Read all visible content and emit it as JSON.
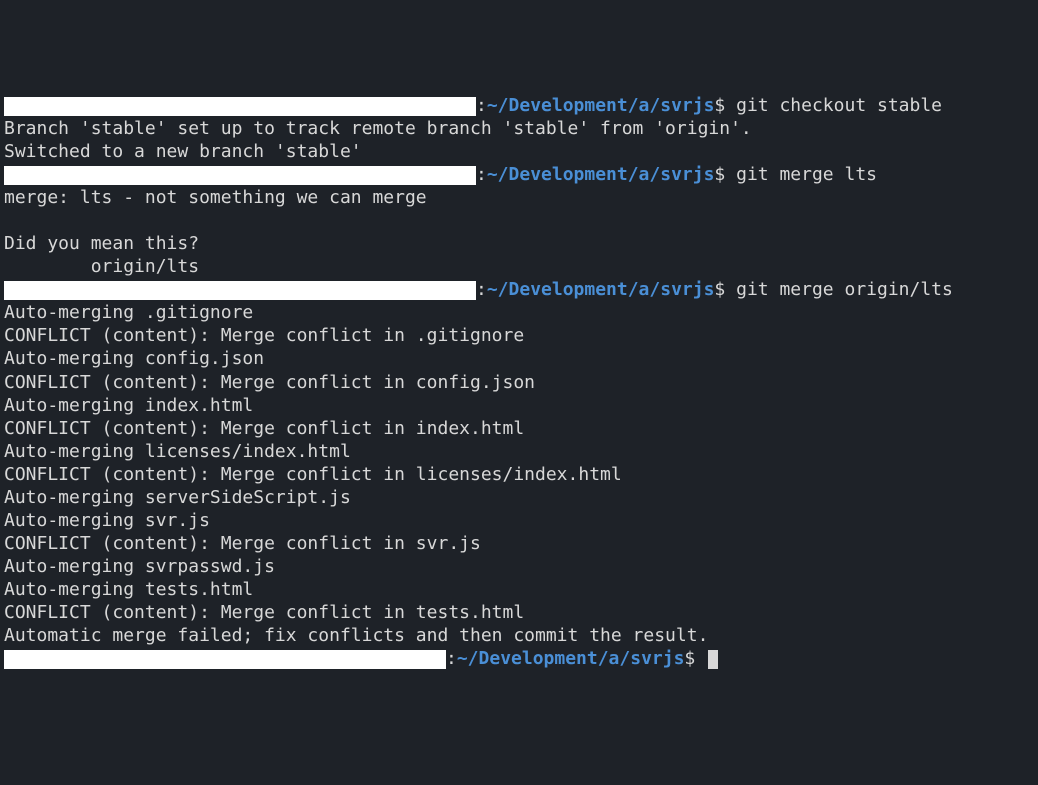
{
  "prompt": {
    "colon": ":",
    "path": "~/Development/a/svrjs",
    "dollar": "$ "
  },
  "blocks": [
    {
      "redactedClass": "r1",
      "command": "git checkout stable",
      "output": [
        "Branch 'stable' set up to track remote branch 'stable' from 'origin'.",
        "Switched to a new branch 'stable'"
      ]
    },
    {
      "redactedClass": "r1",
      "command": "git merge lts",
      "output": [
        "merge: lts - not something we can merge",
        "",
        "Did you mean this?",
        "        origin/lts"
      ]
    },
    {
      "redactedClass": "r1",
      "command": "git merge origin/lts",
      "output": [
        "Auto-merging .gitignore",
        "CONFLICT (content): Merge conflict in .gitignore",
        "Auto-merging config.json",
        "CONFLICT (content): Merge conflict in config.json",
        "Auto-merging index.html",
        "CONFLICT (content): Merge conflict in index.html",
        "Auto-merging licenses/index.html",
        "CONFLICT (content): Merge conflict in licenses/index.html",
        "Auto-merging serverSideScript.js",
        "Auto-merging svr.js",
        "CONFLICT (content): Merge conflict in svr.js",
        "Auto-merging svrpasswd.js",
        "Auto-merging tests.html",
        "CONFLICT (content): Merge conflict in tests.html",
        "Automatic merge failed; fix conflicts and then commit the result."
      ]
    }
  ],
  "finalPrompt": {
    "redactedClass": "r2",
    "command": ""
  }
}
